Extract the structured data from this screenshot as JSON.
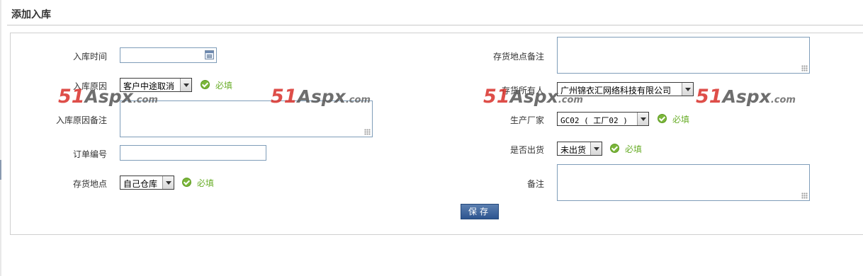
{
  "page": {
    "title": "添加入库"
  },
  "form": {
    "left": {
      "in_time": {
        "label": "入库时间",
        "value": ""
      },
      "reason": {
        "label": "入库原因",
        "selected": "客户中途取消",
        "required": "必填"
      },
      "reason_note": {
        "label": "入库原因备注",
        "value": ""
      },
      "order_no": {
        "label": "订单编号",
        "value": ""
      },
      "location": {
        "label": "存货地点",
        "selected": "自己仓库",
        "required": "必填"
      }
    },
    "right": {
      "location_note": {
        "label": "存货地点备注",
        "value": ""
      },
      "owner": {
        "label": "存货所有人",
        "selected": "广州锦衣汇网络科技有限公司"
      },
      "manufacturer": {
        "label": "生产厂家",
        "selected": "GC02 ( 工厂02 )",
        "required": "必填"
      },
      "shipped": {
        "label": "是否出货",
        "selected": "未出货",
        "required": "必填"
      },
      "remark": {
        "label": "备注",
        "value": ""
      }
    },
    "save_label": "保存"
  },
  "watermark": {
    "num": "51",
    "brand": "Aspx",
    "suffix": ".com"
  },
  "icons": {
    "date": "calendar-icon",
    "required": "check-circle-icon",
    "dropdown": "chevron-down-icon",
    "resize": "resize-grip-icon"
  },
  "colors": {
    "save_button": "#2d5590",
    "required_text": "#6aae2a",
    "input_border": "#7f9db9"
  }
}
